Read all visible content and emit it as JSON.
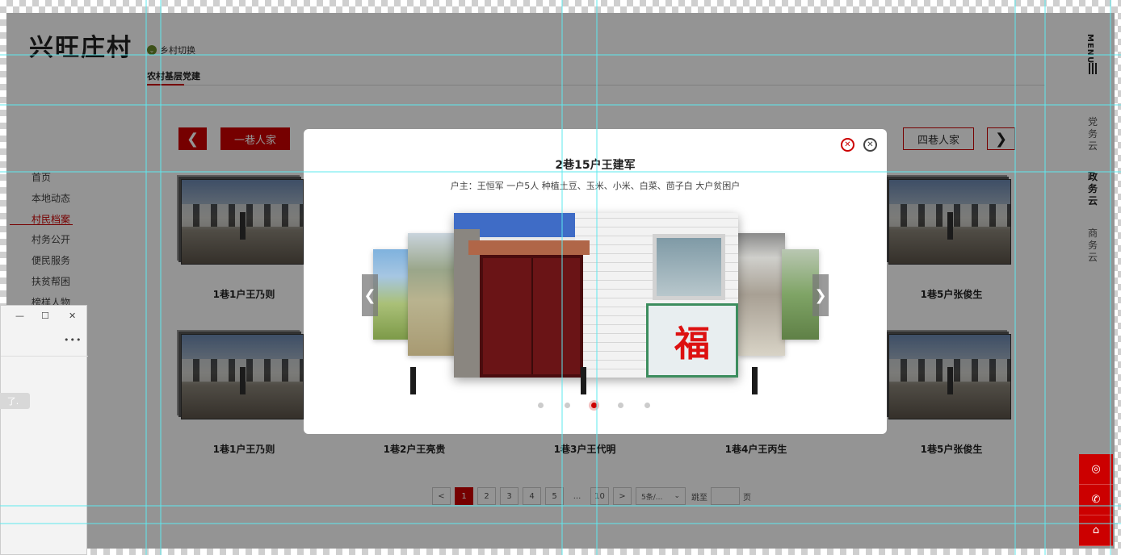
{
  "header": {
    "logo": "兴旺庄村",
    "switch_label": "乡村切换",
    "subtab": "农村基层党建"
  },
  "right_menu": {
    "menu_label": "MENU",
    "clouds": [
      "党务云",
      "政务云",
      "商务云"
    ]
  },
  "side_nav": [
    "首页",
    "本地动态",
    "村民档案",
    "村务公开",
    "便民服务",
    "扶贫帮困",
    "榜样人物"
  ],
  "tabs": {
    "first": "一巷人家",
    "last": "四巷人家"
  },
  "cards_row1": [
    "1巷1户王乃则",
    "",
    "",
    "",
    "1巷5户张俊生"
  ],
  "cards_row2": [
    "1巷1户王乃则",
    "1巷2户王亮贵",
    "1巷3户王代明",
    "1巷4户王丙生",
    "1巷5户张俊生"
  ],
  "pagination": {
    "prev": "<",
    "pages": [
      "1",
      "2",
      "3",
      "4",
      "5",
      "...",
      "10"
    ],
    "next": ">",
    "current": "1",
    "size_select": "5条/...",
    "jump_label": "跳至",
    "page_suffix": "页"
  },
  "modal": {
    "title": "2巷15户王建军",
    "description": "户主：王恒军   一户5人   种植土豆、玉米、小米、白菜、茴子白   大户贫困户",
    "fu_char": "福",
    "active_dot": 3,
    "dot_count": 5
  },
  "right_bar_icons": [
    "chat-icon",
    "phone-icon",
    "home-icon"
  ],
  "side_window": {
    "minimize": "—",
    "maximize": "☐",
    "close": "✕",
    "more": "•••",
    "tip": "了."
  },
  "colors": {
    "accent": "#cc0000",
    "guide": "#5ee8ee"
  }
}
